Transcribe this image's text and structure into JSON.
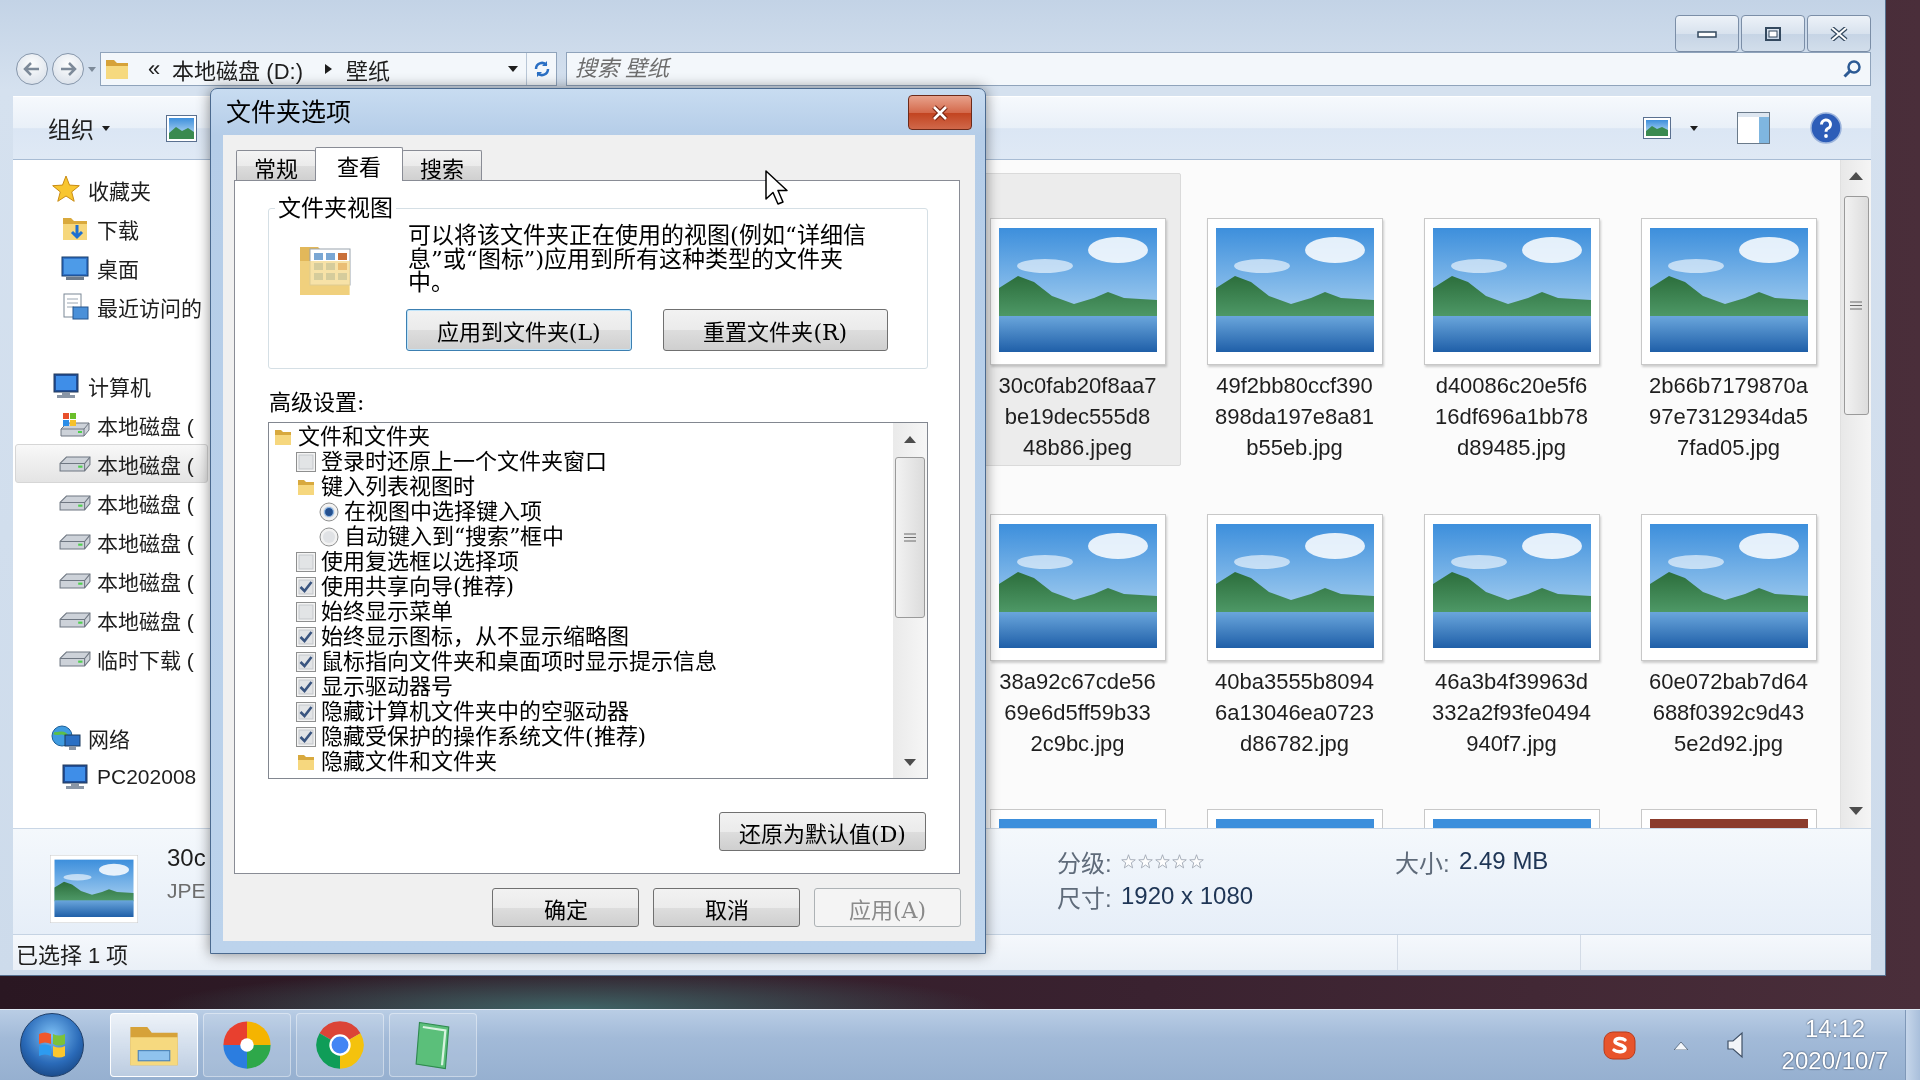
{
  "explorer": {
    "address": {
      "overflow": "«",
      "path": [
        "本地磁盘 (D:)",
        "壁纸"
      ]
    },
    "search": {
      "placeholder": "搜索 壁纸"
    },
    "toolbar": {
      "organize": "组织"
    },
    "nav": [
      {
        "kind": "favorites",
        "label": "收藏夹",
        "selected": false,
        "children": [
          {
            "kind": "downloads",
            "label": "下载",
            "selected": false
          },
          {
            "kind": "desktop",
            "label": "桌面",
            "selected": false
          },
          {
            "kind": "recent",
            "label": "最近访问的",
            "selected": false
          }
        ]
      },
      {
        "kind": "computer",
        "label": "计算机",
        "selected": false,
        "children": [
          {
            "kind": "system-drive",
            "label": "本地磁盘 (",
            "selected": false
          },
          {
            "kind": "drive",
            "label": "本地磁盘 (",
            "selected": true
          },
          {
            "kind": "drive",
            "label": "本地磁盘 (",
            "selected": false
          },
          {
            "kind": "drive",
            "label": "本地磁盘 (",
            "selected": false
          },
          {
            "kind": "drive",
            "label": "本地磁盘 (",
            "selected": false
          },
          {
            "kind": "drive",
            "label": "本地磁盘 (",
            "selected": false
          },
          {
            "kind": "drive",
            "label": "临时下载 (",
            "selected": false
          }
        ]
      },
      {
        "kind": "network",
        "label": "网络",
        "selected": false,
        "children": [
          {
            "kind": "pc",
            "label": "PC202008",
            "selected": false
          }
        ]
      }
    ],
    "files": [
      {
        "name_lines": [
          "30c0fab20f8aa7",
          "be19dec555d8",
          "48b86.jpeg"
        ],
        "selected": true
      },
      {
        "name_lines": [
          "49f2bb80ccf390",
          "898da197e8a81",
          "b55eb.jpg"
        ],
        "selected": false
      },
      {
        "name_lines": [
          "d40086c20e5f6",
          "16df696a1bb78",
          "d89485.jpg"
        ],
        "selected": false
      },
      {
        "name_lines": [
          "2b66b7179870a",
          "97e7312934da5",
          "7fad05.jpg"
        ],
        "selected": false
      },
      {
        "name_lines": [
          "38a92c67cde56",
          "69e6d5ff59b33",
          "2c9bc.jpg"
        ],
        "selected": false
      },
      {
        "name_lines": [
          "40ba3555b8094",
          "6a13046ea0723",
          "d86782.jpg"
        ],
        "selected": false
      },
      {
        "name_lines": [
          "46a3b4f39963d",
          "332a2f93fe0494",
          "940f7.jpg"
        ],
        "selected": false
      },
      {
        "name_lines": [
          "60e072bab7d64",
          "688f0392c9d43",
          "5e2d92.jpg"
        ],
        "selected": false
      }
    ],
    "details": {
      "name": "30c",
      "type": "JPE",
      "rating_label": "分级:",
      "stars": 0,
      "size_label": "大小:",
      "size": "2.49 MB",
      "dimensions_label": "尺寸:",
      "dimensions": "1920 x 1080"
    },
    "status": "已选择 1 项"
  },
  "dialog": {
    "title": "文件夹选项",
    "tabs": [
      {
        "label": "常规",
        "selected": false
      },
      {
        "label": "查看",
        "selected": true
      },
      {
        "label": "搜索",
        "selected": false
      }
    ],
    "folder_views": {
      "legend": "文件夹视图",
      "description": "可以将该文件夹正在使用的视图(例如“详细信息”或“图标”)应用到所有这种类型的文件夹中。",
      "buttons": [
        {
          "label": "应用到文件夹(L)",
          "focused": true
        },
        {
          "label": "重置文件夹(R)",
          "focused": false
        }
      ]
    },
    "advanced": {
      "label": "高级设置:",
      "items": [
        {
          "kind": "folder",
          "label": "文件和文件夹",
          "children": [
            {
              "kind": "checkbox",
              "label": "登录时还原上一个文件夹窗口",
              "checked": false
            },
            {
              "kind": "folder",
              "label": "键入列表视图时",
              "children": [
                {
                  "kind": "radio",
                  "label": "在视图中选择键入项",
                  "selected": true
                },
                {
                  "kind": "radio",
                  "label": "自动键入到“搜索”框中",
                  "selected": false
                }
              ]
            },
            {
              "kind": "checkbox",
              "label": "使用复选框以选择项",
              "checked": false
            },
            {
              "kind": "checkbox",
              "label": "使用共享向导(推荐)",
              "checked": true
            },
            {
              "kind": "checkbox",
              "label": "始终显示菜单",
              "checked": false
            },
            {
              "kind": "checkbox",
              "label": "始终显示图标，从不显示缩略图",
              "checked": true
            },
            {
              "kind": "checkbox",
              "label": "鼠标指向文件夹和桌面项时显示提示信息",
              "checked": true
            },
            {
              "kind": "checkbox",
              "label": "显示驱动器号",
              "checked": true
            },
            {
              "kind": "checkbox",
              "label": "隐藏计算机文件夹中的空驱动器",
              "checked": true
            },
            {
              "kind": "checkbox",
              "label": "隐藏受保护的操作系统文件(推荐)",
              "checked": true
            },
            {
              "kind": "folder",
              "label": "隐藏文件和文件夹"
            }
          ]
        }
      ]
    },
    "restore": "还原为默认值(D)",
    "buttons": [
      {
        "label": "确定",
        "disabled": false
      },
      {
        "label": "取消",
        "disabled": false
      },
      {
        "label": "应用(A)",
        "disabled": true
      }
    ]
  },
  "taskbar": {
    "apps": [
      {
        "kind": "folder",
        "active": true
      },
      {
        "kind": "pinwheel",
        "active": false
      },
      {
        "kind": "browser",
        "active": false
      },
      {
        "kind": "notebook",
        "active": false
      }
    ],
    "time": "14:12",
    "date": "2020/10/7"
  }
}
